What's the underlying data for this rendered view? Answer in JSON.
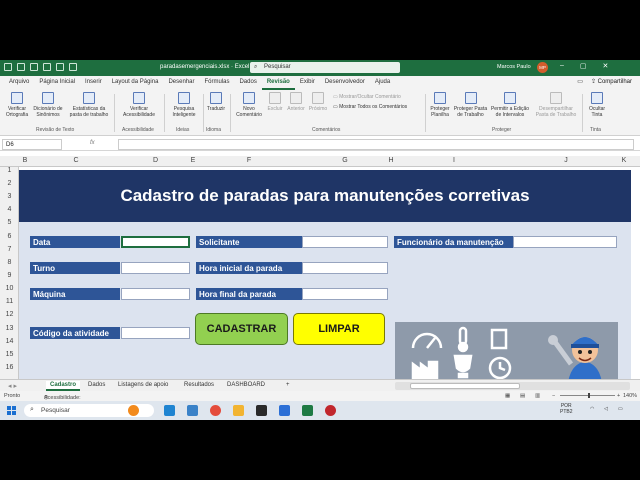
{
  "window": {
    "filename": "paradasemergenciais.xlsx",
    "app": "Excel",
    "search_placeholder": "Pesquisar",
    "user_name": "Marcos Paulo",
    "user_initials": "MP"
  },
  "menu": {
    "tabs": [
      "Arquivo",
      "Página Inicial",
      "Inserir",
      "Layout da Página",
      "Desenhar",
      "Fórmulas",
      "Dados",
      "Revisão",
      "Exibir",
      "Desenvolvedor",
      "Ajuda"
    ],
    "active_tab": "Revisão",
    "share_label": "Compartilhar"
  },
  "ribbon": {
    "buttons": [
      {
        "label": "Verificar Ortografia"
      },
      {
        "label": "Dicionário de Sinônimos"
      },
      {
        "label": "Estatísticas da pasta de trabalho"
      },
      {
        "label": "Verificar Acessibilidade"
      },
      {
        "label": "Pesquisa Inteligente"
      },
      {
        "label": "Traduzir"
      },
      {
        "label": "Novo Comentário"
      },
      {
        "label": "Excluir"
      },
      {
        "label": "Anterior"
      },
      {
        "label": "Próximo"
      },
      {
        "label": "Mostrar/Ocultar Comentário"
      },
      {
        "label": "Mostrar Todos os Comentários"
      },
      {
        "label": "Proteger Planilha"
      },
      {
        "label": "Proteger Pasta de Trabalho"
      },
      {
        "label": "Permitir a Edição de Intervalos"
      },
      {
        "label": "Desempartilhar Pasta de Trabalho"
      },
      {
        "label": "Ocultar Tinta"
      }
    ],
    "groups": [
      "Revisão de Texto",
      "Acessibilidade",
      "Ideias",
      "Idioma",
      "Comentários",
      "Proteger",
      "Tinta"
    ]
  },
  "formula_bar": {
    "name_box": "D6",
    "fx": "fx",
    "value": ""
  },
  "grid": {
    "columns": [
      "B",
      "C",
      "D",
      "E",
      "F",
      "G",
      "H",
      "I",
      "J",
      "K"
    ],
    "rows": [
      "1",
      "2",
      "3",
      "4",
      "5",
      "6",
      "7",
      "8",
      "9",
      "10",
      "11",
      "12",
      "13",
      "14",
      "15",
      "16"
    ]
  },
  "form": {
    "title": "Cadastro de paradas para manutenções corretivas",
    "fields": {
      "data": "Data",
      "solicitante": "Solicitante",
      "funcionario": "Funcionário da manutenção",
      "turno": "Turno",
      "hora_inicial": "Hora inicial da parada",
      "maquina": "Máquina",
      "hora_final": "Hora final da parada",
      "codigo": "Código da atividade"
    },
    "buttons": {
      "cadastrar": "CADASTRAR",
      "limpar": "LIMPAR"
    },
    "colors": {
      "banner": "#1f3566",
      "label": "#2e5597",
      "panel": "#dce3ef",
      "cadastrar": "#92d050",
      "limpar": "#ffff00"
    }
  },
  "sheet_tabs": {
    "tabs": [
      "Cadastro",
      "Dados",
      "Listagens de apoio",
      "Resultados",
      "DASHBOARD"
    ],
    "active": "Cadastro",
    "add": "+"
  },
  "status": {
    "ready": "Pronto",
    "accessibility": "Acessibilidade: investigar",
    "zoom": "140%"
  },
  "taskbar": {
    "search": "Pesquisar",
    "lang_1": "POR",
    "lang_2": "PTB2"
  }
}
